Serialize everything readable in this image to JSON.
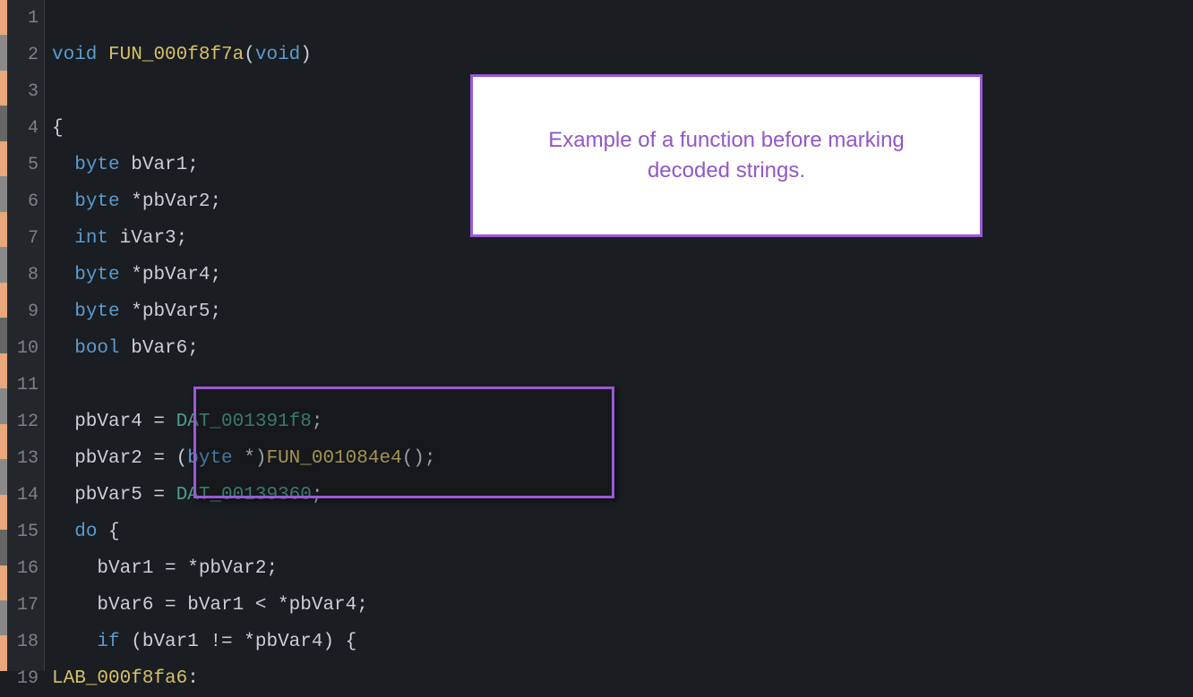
{
  "lines": [
    {
      "num": "1",
      "code": ""
    },
    {
      "num": "2",
      "code": "void FUN_000f8f7a(void)"
    },
    {
      "num": "3",
      "code": ""
    },
    {
      "num": "4",
      "code": "{"
    },
    {
      "num": "5",
      "code": "  byte bVar1;"
    },
    {
      "num": "6",
      "code": "  byte *pbVar2;"
    },
    {
      "num": "7",
      "code": "  int iVar3;"
    },
    {
      "num": "8",
      "code": "  byte *pbVar4;"
    },
    {
      "num": "9",
      "code": "  byte *pbVar5;"
    },
    {
      "num": "10",
      "code": "  bool bVar6;"
    },
    {
      "num": "11",
      "code": ""
    },
    {
      "num": "12",
      "code": "  pbVar4 = DAT_001391f8;"
    },
    {
      "num": "13",
      "code": "  pbVar2 = (byte *)FUN_001084e4();"
    },
    {
      "num": "14",
      "code": "  pbVar5 = DAT_00139360;"
    },
    {
      "num": "15",
      "code": "  do {"
    },
    {
      "num": "16",
      "code": "    bVar1 = *pbVar2;"
    },
    {
      "num": "17",
      "code": "    bVar6 = bVar1 < *pbVar4;"
    },
    {
      "num": "18",
      "code": "    if (bVar1 != *pbVar4) {"
    },
    {
      "num": "19",
      "code": "LAB_000f8fa6:"
    }
  ],
  "tokens": {
    "line2": {
      "t1": "void",
      "t2": " ",
      "t3": "FUN_000f8f7a",
      "t4": "(",
      "t5": "void",
      "t6": ")"
    },
    "line4": {
      "t1": "{"
    },
    "line5": {
      "t1": "  ",
      "t2": "byte",
      "t3": " bVar1;"
    },
    "line6": {
      "t1": "  ",
      "t2": "byte",
      "t3": " *pbVar2;"
    },
    "line7": {
      "t1": "  ",
      "t2": "int",
      "t3": " iVar3;"
    },
    "line8": {
      "t1": "  ",
      "t2": "byte",
      "t3": " *pbVar4;"
    },
    "line9": {
      "t1": "  ",
      "t2": "byte",
      "t3": " *pbVar5;"
    },
    "line10": {
      "t1": "  ",
      "t2": "bool",
      "t3": " bVar6;"
    },
    "line12": {
      "t1": "  pbVar4 = ",
      "t2": "DAT_001391f8",
      "t3": ";"
    },
    "line13": {
      "t1": "  pbVar2 = (",
      "t2": "byte",
      "t3": " *)",
      "t4": "FUN_001084e4",
      "t5": "();"
    },
    "line14": {
      "t1": "  pbVar5 = ",
      "t2": "DAT_00139360",
      "t3": ";"
    },
    "line15": {
      "t1": "  ",
      "t2": "do",
      "t3": " {"
    },
    "line16": {
      "t1": "    bVar1 = *pbVar2;"
    },
    "line17": {
      "t1": "    bVar6 = bVar1 < *pbVar4;"
    },
    "line18": {
      "t1": "    ",
      "t2": "if",
      "t3": " (bVar1 != *pbVar4) {"
    },
    "line19": {
      "t1": "LAB_000f8fa6",
      "t2": ":"
    }
  },
  "callout": {
    "text": "Example of a function before marking decoded strings."
  }
}
